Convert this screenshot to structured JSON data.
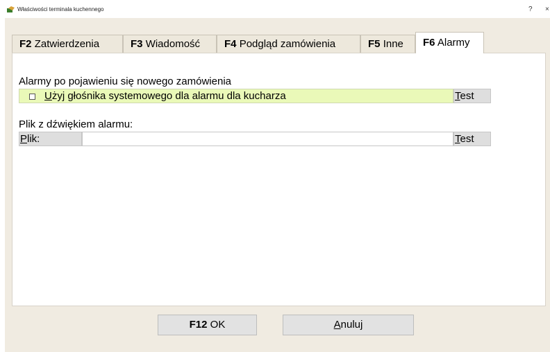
{
  "window": {
    "title": "Właściwości terminala kuchennego",
    "help_glyph": "?",
    "close_glyph": "×"
  },
  "tabs": [
    {
      "key": "F2",
      "label": "Zatwierdzenia"
    },
    {
      "key": "F3",
      "label": "Wiadomość"
    },
    {
      "key": "F4",
      "label": "Podgląd zamówienia"
    },
    {
      "key": "F5",
      "label": "Inne"
    },
    {
      "key": "F6",
      "label": "Alarmy",
      "active": true
    }
  ],
  "alarms": {
    "section_title": "Alarmy po pojawieniu się nowego zamówienia",
    "checkbox_mnemonic": "U",
    "checkbox_rest": "żyj głośnika systemowego dla alarmu dla kucharza",
    "checkbox_checked": false,
    "test_mnemonic": "T",
    "test_rest": "est"
  },
  "sound_file": {
    "section_title": "Plik z dźwiękiem alarmu:",
    "label_mnemonic": "P",
    "label_rest": "lik:",
    "value": "",
    "test_mnemonic": "T",
    "test_rest": "est"
  },
  "footer": {
    "ok_key": "F12",
    "ok_label": "OK",
    "cancel_mnemonic": "A",
    "cancel_rest": "nuluj"
  },
  "colors": {
    "dialog_bg": "#f0ebe1",
    "checkbox_row_bg": "#eaf9b8",
    "button_bg": "#e2e2e2"
  }
}
